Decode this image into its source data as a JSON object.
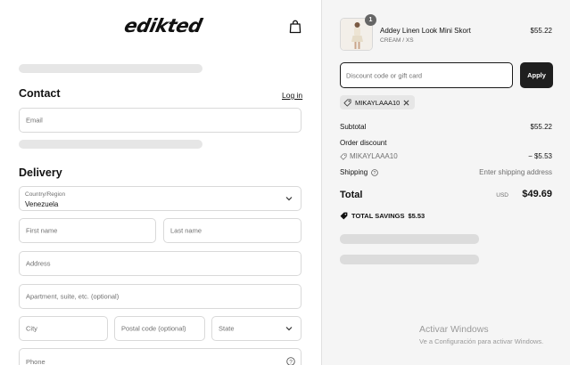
{
  "brand": {
    "logo_text": "edikted"
  },
  "contact": {
    "title": "Contact",
    "login_label": "Log in",
    "email_placeholder": "Email"
  },
  "delivery": {
    "title": "Delivery",
    "country_label": "Country/Region",
    "country_value": "Venezuela",
    "first_name_placeholder": "First name",
    "last_name_placeholder": "Last name",
    "address_placeholder": "Address",
    "apartment_placeholder": "Apartment, suite, etc. (optional)",
    "city_placeholder": "City",
    "postal_placeholder": "Postal code (optional)",
    "state_placeholder": "State",
    "phone_placeholder": "Phone"
  },
  "summary": {
    "product": {
      "quantity": "1",
      "name": "Addey Linen Look Mini Skort",
      "variant": "CREAM / XS",
      "price": "$55.22"
    },
    "discount_placeholder": "Discount code or gift card",
    "apply_label": "Apply",
    "applied_code": "MIKAYLAAA10",
    "subtotal_label": "Subtotal",
    "subtotal_value": "$55.22",
    "order_discount_label": "Order discount",
    "order_discount_code": "MIKAYLAAA10",
    "order_discount_value": "− $5.53",
    "shipping_label": "Shipping",
    "shipping_value": "Enter shipping address",
    "total_label": "Total",
    "total_currency": "USD",
    "total_value": "$49.69",
    "savings_label": "TOTAL SAVINGS",
    "savings_value": "$5.53"
  },
  "windows_watermark": {
    "title": "Activar Windows",
    "subtitle": "Ve a Configuración para activar Windows."
  },
  "colors": {
    "apply_button": "#1f1f1f",
    "summary_background": "#f5f5f5",
    "skeleton": "#e6e6e6"
  }
}
